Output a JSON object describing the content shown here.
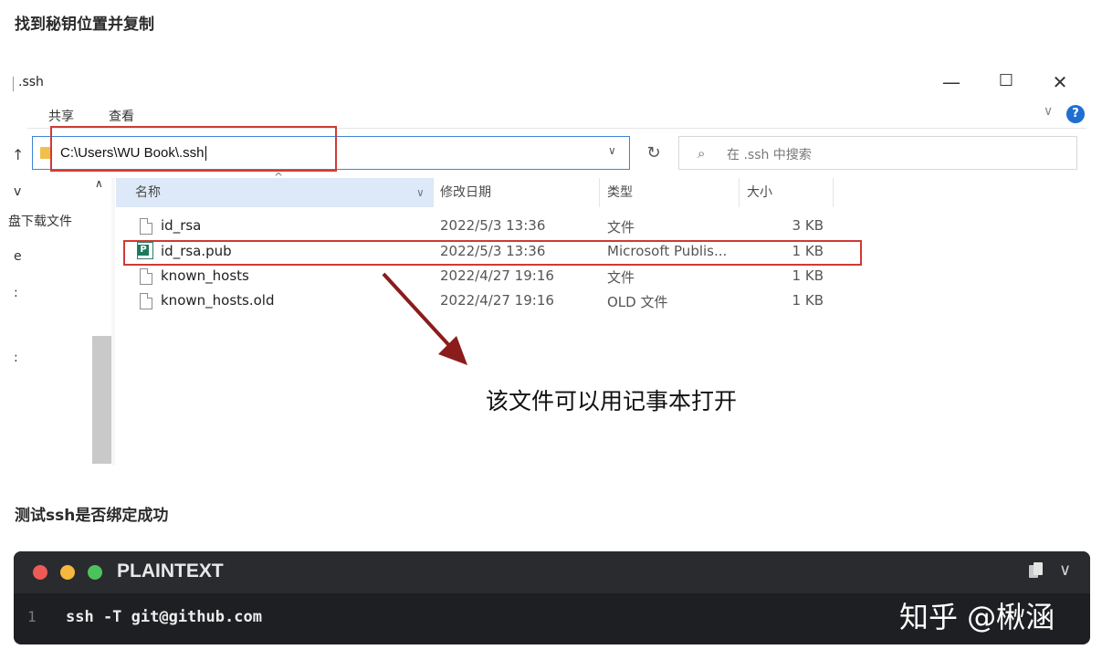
{
  "headings": {
    "step1": "找到秘钥位置并复制",
    "step2": "测试ssh是否绑定成功"
  },
  "explorer": {
    "window_title": ".ssh",
    "window_controls": {
      "minimize": "—",
      "maximize": "☐",
      "close": "✕"
    },
    "ribbon_tabs": [
      "共享",
      "查看"
    ],
    "ribbon_chevron": "∨",
    "help_label": "?",
    "address": {
      "path": "C:\\Users\\WU Book\\.ssh",
      "dropdown": "∨",
      "refresh": "↻",
      "up": "↑"
    },
    "search": {
      "placeholder": "在 .ssh 中搜索",
      "icon": "search-icon"
    },
    "nav": {
      "scroll_up": "∧",
      "items": [
        "v",
        "盘下载文件",
        "e",
        ":",
        ":"
      ]
    },
    "columns": {
      "name": "名称",
      "date": "修改日期",
      "type": "类型",
      "size": "大小",
      "sort_indicator": "^",
      "chevron": "∨"
    },
    "files": [
      {
        "name": "id_rsa",
        "date": "2022/5/3 13:36",
        "type": "文件",
        "size": "3 KB",
        "icon": "file-icon"
      },
      {
        "name": "id_rsa.pub",
        "date": "2022/5/3 13:36",
        "type": "Microsoft Publis...",
        "size": "1 KB",
        "icon": "publisher-icon"
      },
      {
        "name": "known_hosts",
        "date": "2022/4/27 19:16",
        "type": "文件",
        "size": "1 KB",
        "icon": "file-icon"
      },
      {
        "name": "known_hosts.old",
        "date": "2022/4/27 19:16",
        "type": "OLD 文件",
        "size": "1 KB",
        "icon": "file-icon"
      }
    ],
    "annotation": "该文件可以用记事本打开"
  },
  "code_block": {
    "language": "PLAINTEXT",
    "line_number": "1",
    "code": "ssh -T git@github.com",
    "chevron": "∨"
  },
  "watermark": "知乎 @楸涵",
  "colors": {
    "highlight_red": "#d03a34",
    "arrow_red": "#8b1c1c",
    "code_bg": "#1e1f22",
    "selected_header": "#dde9f8"
  }
}
